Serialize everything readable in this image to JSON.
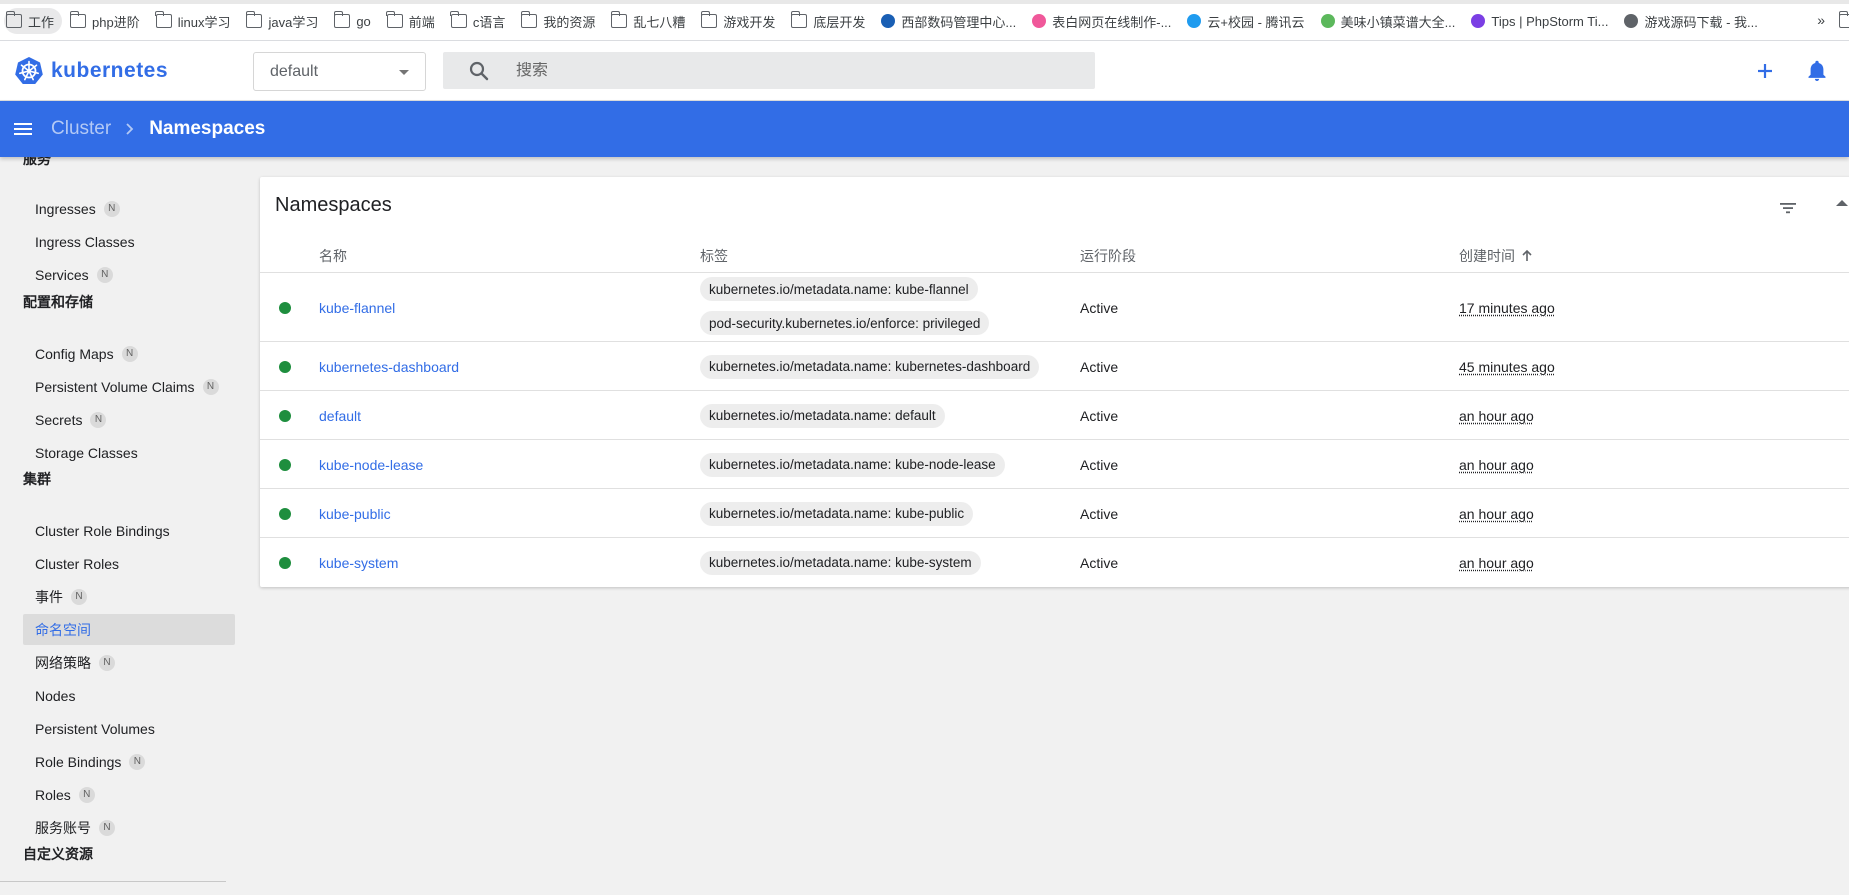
{
  "bookmarks": {
    "items": [
      {
        "label": "工作",
        "icon": "folder-icon"
      },
      {
        "label": "php进阶",
        "icon": "folder-icon"
      },
      {
        "label": "linux学习",
        "icon": "folder-icon"
      },
      {
        "label": "java学习",
        "icon": "folder-icon"
      },
      {
        "label": "go",
        "icon": "folder-icon"
      },
      {
        "label": "前端",
        "icon": "folder-icon"
      },
      {
        "label": "c语言",
        "icon": "folder-icon"
      },
      {
        "label": "我的资源",
        "icon": "folder-icon"
      },
      {
        "label": "乱七八糟",
        "icon": "folder-icon"
      },
      {
        "label": "游戏开发",
        "icon": "folder-icon"
      },
      {
        "label": "底层开发",
        "icon": "folder-icon"
      },
      {
        "label": "西部数码管理中心...",
        "icon": "site-favicon",
        "color": "#1a5fb4"
      },
      {
        "label": "表白网页在线制作-...",
        "icon": "heart-favicon",
        "color": "#f0589a"
      },
      {
        "label": "云+校园 - 腾讯云",
        "icon": "cloud-favicon",
        "color": "#1f9bef"
      },
      {
        "label": "美味小镇菜谱大全...",
        "icon": "site-favicon",
        "color": "#5cb85c"
      },
      {
        "label": "Tips | PhpStorm Ti...",
        "icon": "phpstorm-favicon",
        "color": "#7b3fe4"
      },
      {
        "label": "游戏源码下载 - 我...",
        "icon": "globe-favicon",
        "color": "#5f6368"
      }
    ],
    "overflow": "»"
  },
  "topbar": {
    "logo_text": "kubernetes",
    "namespace_select": "default",
    "search_placeholder": "搜索"
  },
  "breadcrumb": {
    "parent": "Cluster",
    "current": "Namespaces"
  },
  "sidebar": {
    "partial_heading": "服务",
    "items_services": [
      {
        "label": "Ingresses",
        "badge": "N"
      },
      {
        "label": "Ingress Classes",
        "badge": ""
      },
      {
        "label": "Services",
        "badge": "N"
      }
    ],
    "heading_config": "配置和存储",
    "items_config": [
      {
        "label": "Config Maps",
        "badge": "N"
      },
      {
        "label": "Persistent Volume Claims",
        "badge": "N"
      },
      {
        "label": "Secrets",
        "badge": "N"
      },
      {
        "label": "Storage Classes",
        "badge": ""
      }
    ],
    "heading_cluster": "集群",
    "items_cluster": [
      {
        "label": "Cluster Role Bindings",
        "badge": ""
      },
      {
        "label": "Cluster Roles",
        "badge": ""
      },
      {
        "label": "事件",
        "badge": "N"
      },
      {
        "label": "命名空间",
        "badge": "",
        "active": true
      },
      {
        "label": "网络策略",
        "badge": "N"
      },
      {
        "label": "Nodes",
        "badge": ""
      },
      {
        "label": "Persistent Volumes",
        "badge": ""
      },
      {
        "label": "Role Bindings",
        "badge": "N"
      },
      {
        "label": "Roles",
        "badge": "N"
      },
      {
        "label": "服务账号",
        "badge": "N"
      }
    ],
    "heading_custom": "自定义资源"
  },
  "card": {
    "title": "Namespaces",
    "columns": {
      "name": "名称",
      "labels": "标签",
      "phase": "运行阶段",
      "created": "创建时间"
    },
    "rows": [
      {
        "name": "kube-flannel",
        "labels": [
          "kubernetes.io/metadata.name: kube-flannel",
          "pod-security.kubernetes.io/enforce: privileged"
        ],
        "phase": "Active",
        "created": "17 minutes ago"
      },
      {
        "name": "kubernetes-dashboard",
        "labels": [
          "kubernetes.io/metadata.name: kubernetes-dashboard"
        ],
        "phase": "Active",
        "created": "45 minutes ago"
      },
      {
        "name": "default",
        "labels": [
          "kubernetes.io/metadata.name: default"
        ],
        "phase": "Active",
        "created": "an hour ago"
      },
      {
        "name": "kube-node-lease",
        "labels": [
          "kubernetes.io/metadata.name: kube-node-lease"
        ],
        "phase": "Active",
        "created": "an hour ago"
      },
      {
        "name": "kube-public",
        "labels": [
          "kubernetes.io/metadata.name: kube-public"
        ],
        "phase": "Active",
        "created": "an hour ago"
      },
      {
        "name": "kube-system",
        "labels": [
          "kubernetes.io/metadata.name: kube-system"
        ],
        "phase": "Active",
        "created": "an hour ago"
      }
    ]
  },
  "colors": {
    "brand": "#326de6",
    "status_active": "#1e8e3e"
  }
}
